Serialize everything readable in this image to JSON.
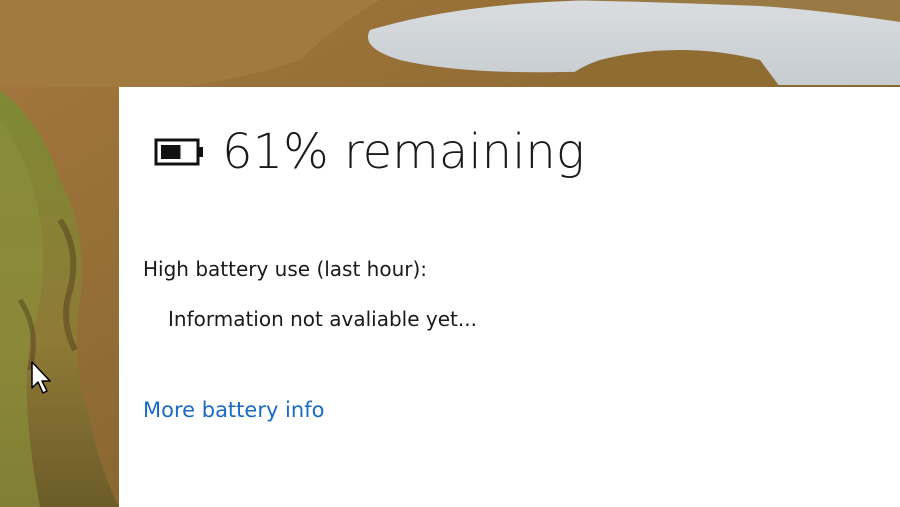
{
  "battery": {
    "status_text": "61% remaining",
    "level_percent": 61,
    "icon": "battery-icon"
  },
  "usage": {
    "heading": "High battery use (last hour):",
    "info": "Information not avaliable yet..."
  },
  "links": {
    "more_battery_info": "More battery info"
  },
  "colors": {
    "link": "#1b6ac4",
    "text": "#1a1a1a",
    "panel": "#ffffff"
  }
}
